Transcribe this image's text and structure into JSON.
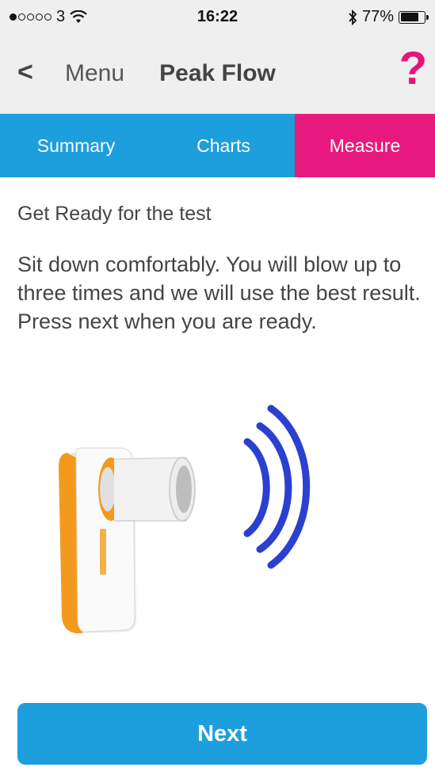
{
  "status_bar": {
    "carrier": "3",
    "time": "16:22",
    "battery_percent": "77%",
    "battery_level": 0.77,
    "signal_bars_filled": 1,
    "signal_bars_total": 5
  },
  "nav": {
    "back_label": "Menu",
    "title": "Peak Flow",
    "help_symbol": "?"
  },
  "tabs": [
    {
      "label": "Summary",
      "active": false
    },
    {
      "label": "Charts",
      "active": false
    },
    {
      "label": "Measure",
      "active": true
    }
  ],
  "main": {
    "heading": "Get Ready for the test",
    "instructions": "Sit down comfortably.  You will blow up to three times and we will use the best result.  Press next when you are ready."
  },
  "next_button": {
    "label": "Next"
  },
  "colors": {
    "tab_blue": "#1d9fdd",
    "tab_active_pink": "#e8197e",
    "help_pink": "#e5157a",
    "wave_blue": "#2b3fd0",
    "device_orange": "#f39a1e"
  },
  "icons": {
    "back": "chevron-left-icon",
    "help": "question-mark-icon",
    "wifi": "wifi-icon",
    "bluetooth": "bluetooth-icon",
    "battery": "battery-icon"
  }
}
